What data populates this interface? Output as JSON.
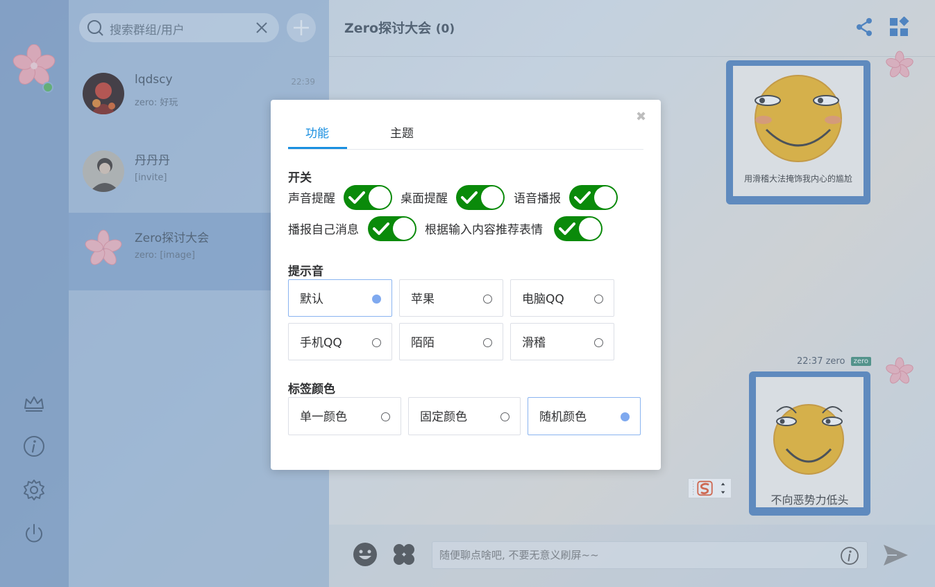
{
  "search": {
    "placeholder": "搜索群组/用户"
  },
  "contacts": [
    {
      "name": "lqdscy",
      "last_message": "zero: 好玩",
      "time": "22:39"
    },
    {
      "name": "丹丹丹",
      "last_message": "[invite]",
      "time": ""
    },
    {
      "name": "Zero探讨大会",
      "last_message": "zero: [image]",
      "time": ""
    }
  ],
  "chat": {
    "title": "Zero探讨大会",
    "member_count": "(0)",
    "messages": [
      {
        "caption": "用滑稽大法掩饰我内心的尴尬"
      },
      {
        "time": "22:37",
        "sender": "zero",
        "badge": "zero",
        "caption": "不向恶势力低头"
      }
    ],
    "input_placeholder": "随便聊点啥吧, 不要无意义刷屏~~"
  },
  "settings_modal": {
    "close_glyph": "✖",
    "tabs": [
      {
        "label": "功能",
        "active": true
      },
      {
        "label": "主题",
        "active": false
      }
    ],
    "switches_title": "开关",
    "switches": [
      {
        "label": "声音提醒",
        "on": true
      },
      {
        "label": "桌面提醒",
        "on": true
      },
      {
        "label": "语音播报",
        "on": true
      },
      {
        "label": "播报自己消息",
        "on": true
      },
      {
        "label": "根据输入内容推荐表情",
        "on": true
      }
    ],
    "sound_title": "提示音",
    "sounds": [
      {
        "label": "默认",
        "selected": true
      },
      {
        "label": "苹果",
        "selected": false
      },
      {
        "label": "电脑QQ",
        "selected": false
      },
      {
        "label": "手机QQ",
        "selected": false
      },
      {
        "label": "陌陌",
        "selected": false
      },
      {
        "label": "滑稽",
        "selected": false
      }
    ],
    "tag_color_title": "标签颜色",
    "tag_colors": [
      {
        "label": "单一颜色",
        "selected": false
      },
      {
        "label": "固定颜色",
        "selected": false
      },
      {
        "label": "随机颜色",
        "selected": true
      }
    ]
  },
  "colors": {
    "accent": "#1a8fe0",
    "toggle_on": "#0a8a0a",
    "radio_selected": "#7fa9ef",
    "bubble": "#4e80bd",
    "online": "#55b25c"
  },
  "icons": {
    "logo": "sakura-icon",
    "sidebar": [
      "crown-icon",
      "info-icon",
      "gear-icon",
      "power-icon"
    ],
    "header": [
      "share-icon",
      "apps-icon"
    ],
    "composer": [
      "emoji-icon",
      "clover-icon",
      "info-icon",
      "send-icon"
    ]
  }
}
